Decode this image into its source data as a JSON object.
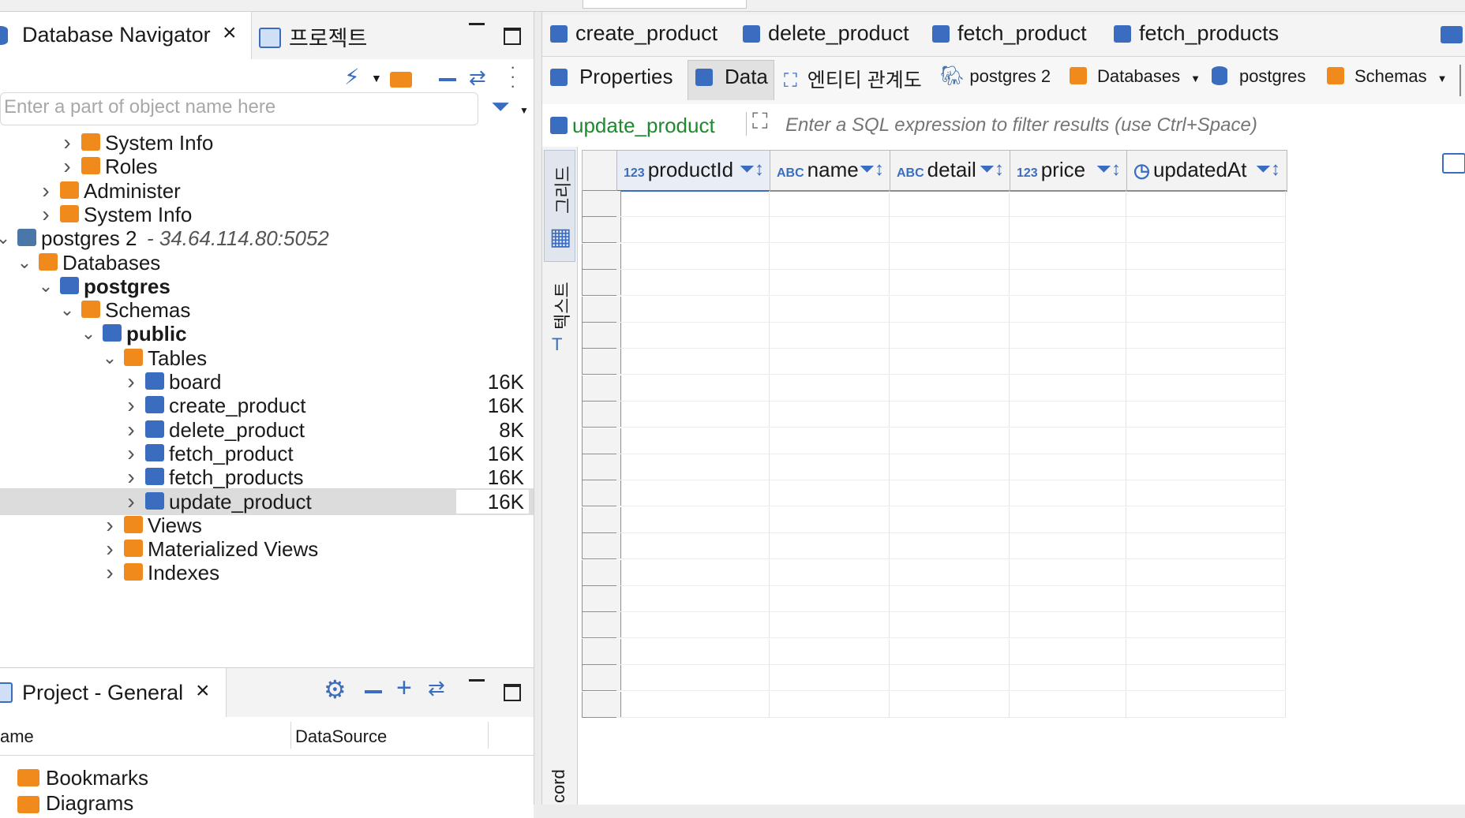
{
  "left": {
    "tabs": [
      {
        "label": "Database Navigator"
      },
      {
        "label": "프로젝트"
      }
    ],
    "filter_placeholder": "Enter a part of object name here",
    "tree": [
      {
        "label": "System Info",
        "indent": 3,
        "chevron": "›",
        "icon": "info-folder-icon",
        "color": "#f08a1c"
      },
      {
        "label": "Roles",
        "indent": 3,
        "chevron": "›",
        "icon": "roles-folder-icon",
        "color": "#f08a1c"
      },
      {
        "label": "Administer",
        "indent": 2,
        "chevron": "›",
        "icon": "admin-folder-icon",
        "color": "#f08a1c"
      },
      {
        "label": "System Info",
        "indent": 2,
        "chevron": "›",
        "icon": "info-folder-icon",
        "color": "#f08a1c"
      },
      {
        "label": "postgres 2",
        "suffix": " - 34.64.114.80:5052",
        "indent": 0,
        "chevron": "⌄",
        "icon": "postgres-elephant-icon",
        "color": "#4a77a8"
      },
      {
        "label": "Databases",
        "indent": 1,
        "chevron": "⌄",
        "icon": "databases-folder-icon",
        "color": "#f08a1c"
      },
      {
        "label": "postgres",
        "indent": 2,
        "chevron": "⌄",
        "icon": "database-icon",
        "color": "#3a6dbf",
        "bold": true
      },
      {
        "label": "Schemas",
        "indent": 3,
        "chevron": "⌄",
        "icon": "schemas-folder-icon",
        "color": "#f08a1c"
      },
      {
        "label": "public",
        "indent": 4,
        "chevron": "⌄",
        "icon": "schema-icon",
        "color": "#3a6dbf",
        "bold": true
      },
      {
        "label": "Tables",
        "indent": 5,
        "chevron": "⌄",
        "icon": "tables-folder-icon",
        "color": "#f08a1c"
      },
      {
        "label": "board",
        "indent": 6,
        "chevron": "›",
        "icon": "table-icon",
        "color": "#3a6dbf",
        "size": "16K"
      },
      {
        "label": "create_product",
        "indent": 6,
        "chevron": "›",
        "icon": "table-icon",
        "color": "#3a6dbf",
        "size": "16K"
      },
      {
        "label": "delete_product",
        "indent": 6,
        "chevron": "›",
        "icon": "table-icon",
        "color": "#3a6dbf",
        "size": "8K"
      },
      {
        "label": "fetch_product",
        "indent": 6,
        "chevron": "›",
        "icon": "table-icon",
        "color": "#3a6dbf",
        "size": "16K"
      },
      {
        "label": "fetch_products",
        "indent": 6,
        "chevron": "›",
        "icon": "table-icon",
        "color": "#3a6dbf",
        "size": "16K"
      },
      {
        "label": "update_product",
        "indent": 6,
        "chevron": "›",
        "icon": "table-icon",
        "color": "#3a6dbf",
        "size": "16K",
        "selected": true
      },
      {
        "label": "Views",
        "indent": 5,
        "chevron": "›",
        "icon": "views-folder-icon",
        "color": "#f08a1c"
      },
      {
        "label": "Materialized Views",
        "indent": 5,
        "chevron": "›",
        "icon": "views-folder-icon",
        "color": "#f08a1c"
      },
      {
        "label": "Indexes",
        "indent": 5,
        "chevron": "›",
        "icon": "indexes-folder-icon",
        "color": "#f08a1c"
      }
    ],
    "project": {
      "tab": "Project - General",
      "columns": [
        "ame",
        "DataSource"
      ],
      "items": [
        {
          "label": "Bookmarks"
        },
        {
          "label": "Diagrams"
        }
      ]
    }
  },
  "right": {
    "editor_tabs": [
      "create_product",
      "delete_product",
      "fetch_product",
      "fetch_products"
    ],
    "sub_tabs": {
      "properties": "Properties",
      "data": "Data",
      "er": "엔티티 관계도",
      "connection": "postgres 2",
      "databases": "Databases",
      "database": "postgres",
      "schemas": "Schemas"
    },
    "filter": {
      "table_name": "update_product",
      "placeholder": "Enter a SQL expression to filter results (use Ctrl+Space)"
    },
    "view_tabs": {
      "grid": "그리드",
      "text": "텍스트",
      "record": "cord"
    },
    "columns": [
      {
        "type": "123",
        "name": "productId"
      },
      {
        "type": "ABC",
        "name": "name"
      },
      {
        "type": "ABC",
        "name": "detail"
      },
      {
        "type": "123",
        "name": "price"
      },
      {
        "type": "clock",
        "name": "updatedAt"
      }
    ]
  },
  "colors": {
    "accent": "#3a6dbf",
    "folder": "#f08a1c",
    "selection": "#dcdcdc",
    "link_green": "#1d8a2e"
  }
}
